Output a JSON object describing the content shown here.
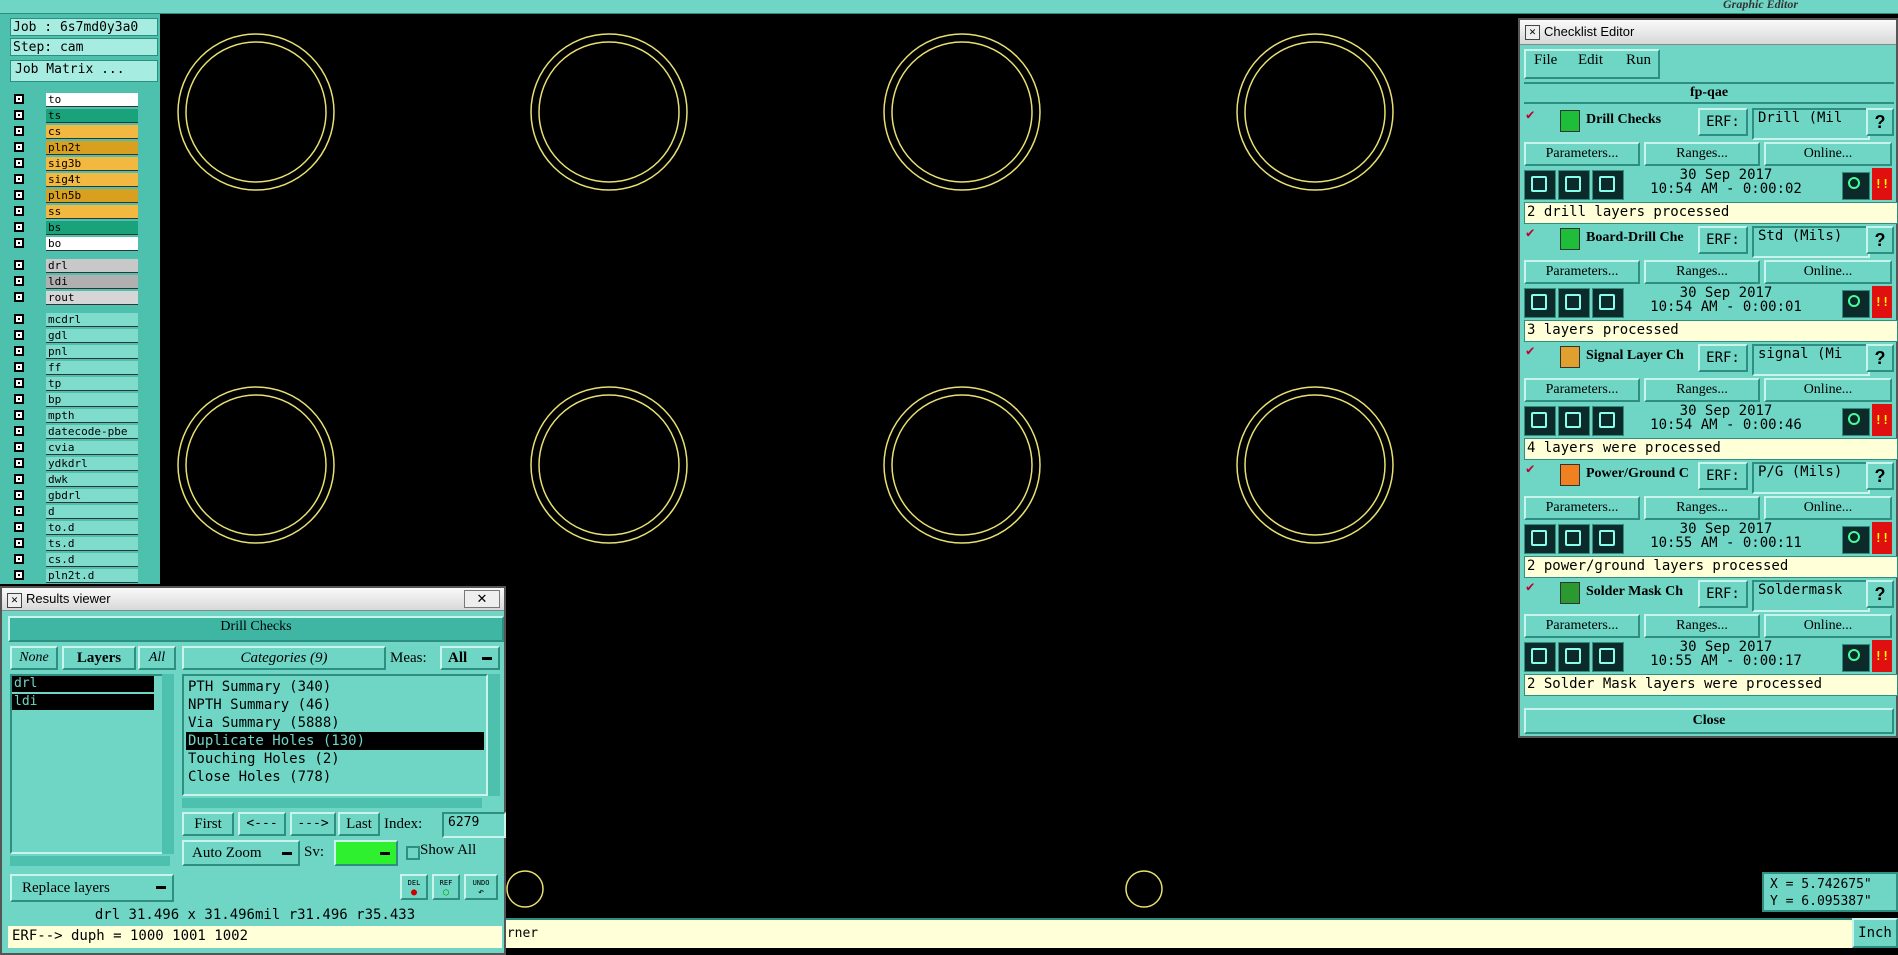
{
  "top": {
    "graphic_editor_title": "Graphic Editor"
  },
  "job": {
    "job_label": "Job : 6s7md0y3a0",
    "step_label": "Step: cam",
    "job_matrix_button": "Job Matrix ..."
  },
  "layers": [
    {
      "name": "to",
      "color": "#ffffff"
    },
    {
      "name": "ts",
      "color": "#1aa37a"
    },
    {
      "name": "cs",
      "color": "#f2b840"
    },
    {
      "name": "pln2t",
      "color": "#d9a020"
    },
    {
      "name": "sig3b",
      "color": "#f2b840"
    },
    {
      "name": "sig4t",
      "color": "#f2b840"
    },
    {
      "name": "pln5b",
      "color": "#d9a020"
    },
    {
      "name": "ss",
      "color": "#f2b840"
    },
    {
      "name": "bs",
      "color": "#1aa37a"
    },
    {
      "name": "bo",
      "color": "#ffffff"
    }
  ],
  "drill_layers": [
    {
      "name": "drl",
      "color": "#c8c8c8"
    },
    {
      "name": "ldi",
      "color": "#b0b0b0"
    },
    {
      "name": "rout",
      "color": "#d6d6d6"
    }
  ],
  "misc_layers": [
    {
      "name": "mcdrl"
    },
    {
      "name": "gdl"
    },
    {
      "name": "pnl"
    },
    {
      "name": "ff"
    },
    {
      "name": "tp"
    },
    {
      "name": "bp"
    },
    {
      "name": "mpth"
    },
    {
      "name": "datecode-pbe"
    },
    {
      "name": "cvia"
    },
    {
      "name": "ydkdrl"
    },
    {
      "name": "dwk"
    },
    {
      "name": "gbdrl"
    },
    {
      "name": "d"
    },
    {
      "name": "to.d"
    },
    {
      "name": "ts.d"
    },
    {
      "name": "cs.d"
    },
    {
      "name": "pln2t.d"
    }
  ],
  "coords": {
    "x": "X = 5.742675\"",
    "y": "Y = 6.095387\""
  },
  "status": {
    "text": "orner",
    "unit": "Inch"
  },
  "checklist": {
    "title": "Checklist Editor",
    "menu": [
      "File",
      "Edit",
      "Run"
    ],
    "name": "fp-qae",
    "erf_label": "ERF:",
    "params_label": "Parameters...",
    "ranges_label": "Ranges...",
    "online_label": "Online...",
    "close_label": "Close",
    "alert_glyph": "!!",
    "checks": [
      {
        "title": "Drill Checks",
        "erf": "Drill (Mil",
        "date": "30 Sep 2017",
        "time": "10:54 AM - 0:00:02",
        "msg": "2 drill layers processed",
        "icon_color": "#1ebd3a"
      },
      {
        "title": "Board-Drill Che",
        "erf": "Std (Mils)",
        "date": "30 Sep 2017",
        "time": "10:54 AM - 0:00:01",
        "msg": "3 layers processed",
        "icon_color": "#1ebd3a"
      },
      {
        "title": "Signal Layer Ch",
        "erf": "signal (Mi",
        "date": "30 Sep 2017",
        "time": "10:54 AM - 0:00:46",
        "msg": "4 layers were processed",
        "icon_color": "#e0a030"
      },
      {
        "title": "Power/Ground C",
        "erf": "P/G (Mils)",
        "date": "30 Sep 2017",
        "time": "10:55 AM - 0:00:11",
        "msg": "2 power/ground layers processed",
        "icon_color": "#f08020"
      },
      {
        "title": "Solder Mask Ch",
        "erf": "Soldermask",
        "date": "30 Sep 2017",
        "time": "10:55 AM - 0:00:17",
        "msg": "2 Solder Mask layers were processed",
        "icon_color": "#2a9a30"
      }
    ]
  },
  "results": {
    "title": "Results viewer",
    "header": "Drill Checks",
    "none_btn": "None",
    "layers_label": "Layers",
    "all_btn": "All",
    "layer_items": [
      "drl",
      "ldi"
    ],
    "categories_label": "Categories (9)",
    "meas_label": "Meas:",
    "meas_value": "All",
    "categories": [
      {
        "label": "PTH Summary (340)",
        "selected": false
      },
      {
        "label": "NPTH Summary (46)",
        "selected": false
      },
      {
        "label": "Via Summary (5888)",
        "selected": false
      },
      {
        "label": "Duplicate Holes (130)",
        "selected": true
      },
      {
        "label": "Touching Holes (2)",
        "selected": false
      },
      {
        "label": "Close Holes (778)",
        "selected": false
      }
    ],
    "first_btn": "First",
    "prev_btn": "<---",
    "next_btn": "--->",
    "last_btn": "Last",
    "index_label": "Index:",
    "index_value": "6279",
    "zoom_value": "Auto Zoom",
    "sv_label": "Sv:",
    "show_all": "Show All",
    "replace_value": "Replace layers",
    "del_label": "DEL",
    "ref_label": "REF",
    "undo_label": "UNDO",
    "info_line": "drl 31.496 x 31.496mil  r31.496  r35.433",
    "erf_line": "ERF--> duph = 1000 1001 1002"
  }
}
